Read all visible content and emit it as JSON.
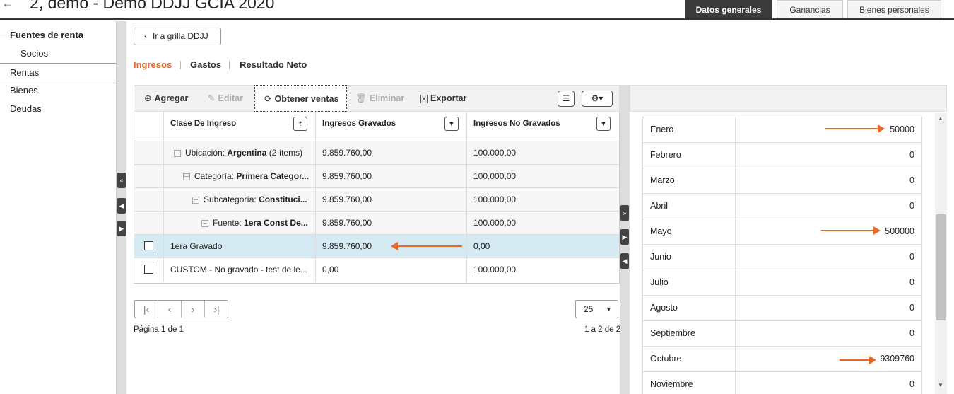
{
  "header": {
    "title": "2, demo - Demo DDJJ GCIA 2020",
    "tabs": [
      "Datos generales",
      "Ganancias",
      "Bienes personales"
    ]
  },
  "sidebar": {
    "group_label": "Fuentes de renta",
    "items": [
      "Socios",
      "Rentas",
      "Bienes",
      "Deudas"
    ],
    "selected": "Rentas"
  },
  "main": {
    "back_button": "Ir a grilla DDJJ",
    "subtabs": [
      "Ingresos",
      "Gastos",
      "Resultado Neto"
    ],
    "active_subtab": "Ingresos",
    "toolbar": {
      "add": "Agregar",
      "edit": "Editar",
      "fetch_sales": "Obtener ventas",
      "delete": "Eliminar",
      "export": "Exportar"
    },
    "grid": {
      "columns": [
        "Clase De Ingreso",
        "Ingresos Gravados",
        "Ingresos No Gravados"
      ],
      "group_rows": [
        {
          "label": "Ubicación:",
          "value": "Argentina",
          "suffix": "(2 ítems)",
          "gravados": "9.859.760,00",
          "no_gravados": "100.000,00"
        },
        {
          "label": "Categoría:",
          "value": "Primera Categor...",
          "suffix": "",
          "gravados": "9.859.760,00",
          "no_gravados": "100.000,00"
        },
        {
          "label": "Subcategoría:",
          "value": "Constituci...",
          "suffix": "",
          "gravados": "9.859.760,00",
          "no_gravados": "100.000,00"
        },
        {
          "label": "Fuente:",
          "value": "1era Const De...",
          "suffix": "",
          "gravados": "9.859.760,00",
          "no_gravados": "100.000,00"
        }
      ],
      "data_rows": [
        {
          "clase": "1era Gravado",
          "gravados": "9.859.760,00",
          "no_gravados": "0,00",
          "selected": true
        },
        {
          "clase": "CUSTOM - No gravado - test de le...",
          "gravados": "0,00",
          "no_gravados": "100.000,00",
          "selected": false
        }
      ]
    },
    "pager": {
      "page_text": "Página 1 de 1",
      "page_size": "25",
      "range_text": "1 a 2 de 2"
    }
  },
  "months_panel": {
    "rows": [
      {
        "month": "Enero",
        "value": "50000"
      },
      {
        "month": "Febrero",
        "value": "0"
      },
      {
        "month": "Marzo",
        "value": "0"
      },
      {
        "month": "Abril",
        "value": "0"
      },
      {
        "month": "Mayo",
        "value": "500000"
      },
      {
        "month": "Junio",
        "value": "0"
      },
      {
        "month": "Julio",
        "value": "0"
      },
      {
        "month": "Agosto",
        "value": "0"
      },
      {
        "month": "Septiembre",
        "value": "0"
      },
      {
        "month": "Octubre",
        "value": "9309760"
      },
      {
        "month": "Noviembre",
        "value": "0"
      }
    ]
  },
  "colors": {
    "accent": "#e8682a",
    "selected_row": "#d6eaf3",
    "active_tab": "#3b3b3b"
  }
}
